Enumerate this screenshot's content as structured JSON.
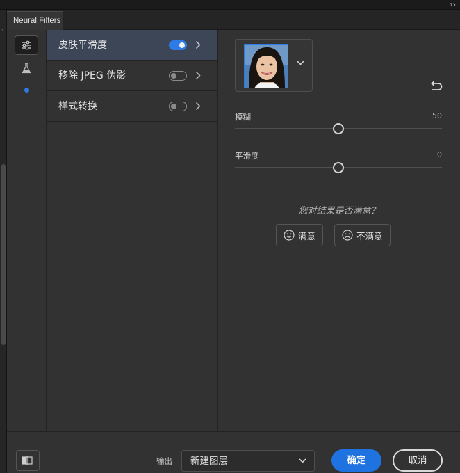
{
  "window": {
    "tab_title": "Neural Filters",
    "collapse_glyph": "››"
  },
  "sidebar": {
    "icons": [
      "sliders-icon",
      "flask-icon"
    ],
    "indicator_color": "#2e7be6"
  },
  "filters": [
    {
      "label": "皮肤平滑度",
      "enabled": true,
      "selected": true
    },
    {
      "label": "移除 JPEG 伪影",
      "enabled": false,
      "selected": false
    },
    {
      "label": "样式转换",
      "enabled": false,
      "selected": false
    }
  ],
  "settings": {
    "sliders": [
      {
        "label": "模糊",
        "value": "50",
        "position": 0.5
      },
      {
        "label": "平滑度",
        "value": "0",
        "position": 0.5
      }
    ],
    "feedback": {
      "question": "您对结果是否满意？",
      "satisfied": "满意",
      "unsatisfied": "不满意"
    }
  },
  "footer": {
    "output_label": "输出",
    "output_value": "新建图层",
    "ok": "确定",
    "cancel": "取消"
  },
  "colors": {
    "accent": "#1f73e0",
    "selected_row": "#3c4657",
    "panel": "#323232"
  }
}
